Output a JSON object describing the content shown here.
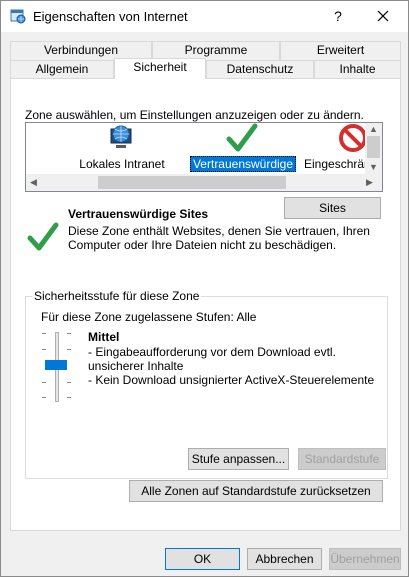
{
  "window": {
    "title": "Eigenschaften von Internet",
    "help_symbol": "?",
    "close_icon": "close-icon"
  },
  "tabs": {
    "top_row": [
      "Verbindungen",
      "Programme",
      "Erweitert"
    ],
    "bottom_row": [
      "Allgemein",
      "Sicherheit",
      "Datenschutz",
      "Inhalte"
    ],
    "active": "Sicherheit"
  },
  "zones": {
    "instruction": "Zone auswählen, um Einstellungen anzuzeigen oder zu ändern.",
    "items": [
      {
        "label": "Lokales Intranet",
        "icon": "globe-monitor-icon",
        "selected": false
      },
      {
        "label": "Vertrauenswürdige",
        "icon": "checkmark-icon",
        "selected": true
      },
      {
        "label": "Eingeschränkte",
        "icon": "restricted-icon",
        "selected": false
      }
    ]
  },
  "selected_zone": {
    "title": "Vertrauenswürdige Sites",
    "description": "Diese Zone enthält Websites, denen Sie vertrauen, Ihren Computer oder Ihre Dateien nicht zu beschädigen.",
    "sites_button": "Sites"
  },
  "security_level": {
    "group_title": "Sicherheitsstufe für diese Zone",
    "allowed_levels": "Für diese Zone zugelassene Stufen: Alle",
    "level_name": "Mittel",
    "level_details": [
      "- Eingabeaufforderung vor dem Download evtl. unsicherer Inhalte",
      "- Kein Download unsignierter ActiveX-Steuerelemente"
    ],
    "custom_level_button": "Stufe anpassen...",
    "default_level_button": "Standardstufe",
    "reset_all_button": "Alle Zonen auf Standardstufe zurücksetzen"
  },
  "footer": {
    "ok": "OK",
    "cancel": "Abbrechen",
    "apply": "Übernehmen"
  },
  "colors": {
    "accent": "#0078d7",
    "check_green": "#2e9e4a",
    "restricted_red": "#d32f2f"
  }
}
